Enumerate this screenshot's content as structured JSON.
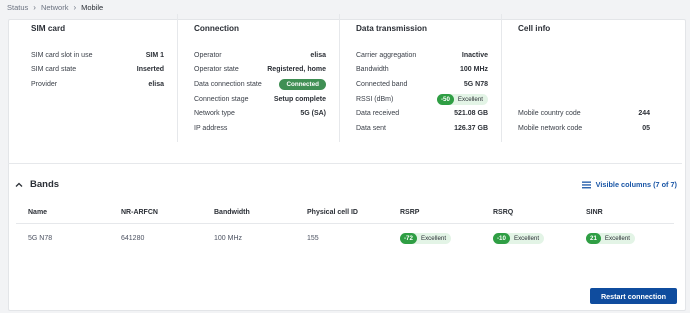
{
  "breadcrumb": [
    "Status",
    "Network",
    "Mobile"
  ],
  "sections": {
    "sim": {
      "title": "SIM card",
      "rows": [
        {
          "k": "SIM card slot in use",
          "v": "SIM 1"
        },
        {
          "k": "SIM card state",
          "v": "Inserted"
        },
        {
          "k": "Provider",
          "v": "elisa"
        }
      ]
    },
    "connection": {
      "title": "Connection",
      "rows": [
        {
          "k": "Operator",
          "v": "elisa"
        },
        {
          "k": "Operator state",
          "v": "Registered, home"
        },
        {
          "k": "Data connection state",
          "v": "Connected"
        },
        {
          "k": "Connection stage",
          "v": "Setup complete"
        },
        {
          "k": "Network type",
          "v": "5G (SA)"
        },
        {
          "k": "IP address",
          "v": ""
        }
      ]
    },
    "data": {
      "title": "Data transmission",
      "rows": [
        {
          "k": "Carrier aggregation",
          "v": "Inactive"
        },
        {
          "k": "Bandwidth",
          "v": "100 MHz"
        },
        {
          "k": "Connected band",
          "v": "5G N78"
        },
        {
          "k": "RSSI (dBm)",
          "num": "-50",
          "quality": "Excellent"
        },
        {
          "k": "Data received",
          "v": "521.08 GB"
        },
        {
          "k": "Data sent",
          "v": "126.37 GB"
        }
      ]
    },
    "cell": {
      "title": "Cell info",
      "rows": [
        {
          "k": "Mobile country code",
          "v": "244"
        },
        {
          "k": "Mobile network code",
          "v": "05"
        }
      ]
    }
  },
  "bands": {
    "title": "Bands",
    "visible_columns": "Visible columns (7 of 7)",
    "headers": [
      "Name",
      "NR-ARFCN",
      "Bandwidth",
      "Physical cell ID",
      "RSRP",
      "RSRQ",
      "SINR"
    ],
    "row": {
      "name": "5G N78",
      "arfcn": "641280",
      "bandwidth": "100 MHz",
      "pci": "155",
      "rsrp": {
        "num": "-72",
        "quality": "Excellent"
      },
      "rsrq": {
        "num": "-10",
        "quality": "Excellent"
      },
      "sinr": {
        "num": "21",
        "quality": "Excellent"
      }
    }
  },
  "actions": {
    "restart": "Restart connection"
  },
  "colors": {
    "accent": "#0f4c9e",
    "success": "#2f9e44"
  }
}
